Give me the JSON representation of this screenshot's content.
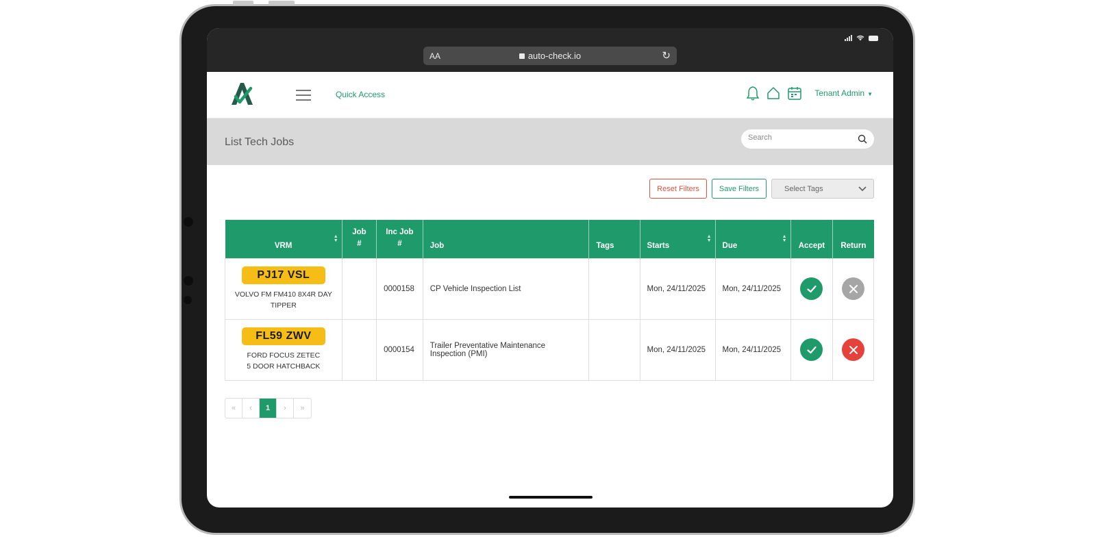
{
  "browser": {
    "text_size_label": "AA",
    "url": "auto-check.io"
  },
  "header": {
    "quick_access": "Quick Access",
    "user_label": "Tenant Admin"
  },
  "page": {
    "title": "List Tech Jobs",
    "search_placeholder": "Search"
  },
  "filters": {
    "reset_label": "Reset Filters",
    "save_label": "Save Filters",
    "select_tags_label": "Select Tags"
  },
  "table": {
    "columns": {
      "vrm": "VRM",
      "job_no_1": "Job",
      "job_no_2": "#",
      "inc_job_1": "Inc Job",
      "inc_job_2": "#",
      "job": "Job",
      "tags": "Tags",
      "starts": "Starts",
      "due": "Due",
      "accept": "Accept",
      "return": "Return"
    },
    "rows": [
      {
        "plate": "PJ17 VSL",
        "vehicle_line1": "VOLVO FM FM410 8X4R DAY",
        "vehicle_line2": "TIPPER",
        "job_no": "",
        "inc_job_no": "0000158",
        "job": "CP Vehicle Inspection List",
        "job_line2": "",
        "tags": "",
        "starts": "Mon, 24/11/2025",
        "due": "Mon, 24/11/2025",
        "return_state": "disabled"
      },
      {
        "plate": "FL59 ZWV",
        "vehicle_line1": "FORD FOCUS ZETEC",
        "vehicle_line2": "5 DOOR HATCHBACK",
        "job_no": "",
        "inc_job_no": "0000154",
        "job": "Trailer Preventative Maintenance",
        "job_line2": "Inspection (PMI)",
        "tags": "",
        "starts": "Mon, 24/11/2025",
        "due": "Mon, 24/11/2025",
        "return_state": "active"
      }
    ]
  },
  "pagination": {
    "first": "«",
    "prev": "‹",
    "current": "1",
    "next": "›",
    "last": "»"
  },
  "colors": {
    "brand_green": "#1f9a6a",
    "plate_yellow": "#f6bd17",
    "danger_red": "#e5423b",
    "disabled_grey": "#a6a6a6"
  },
  "icons": [
    "notification-bell-icon",
    "home-icon",
    "calendar-icon",
    "search-icon",
    "check-icon",
    "close-icon",
    "chevron-down-icon",
    "menu-icon"
  ]
}
